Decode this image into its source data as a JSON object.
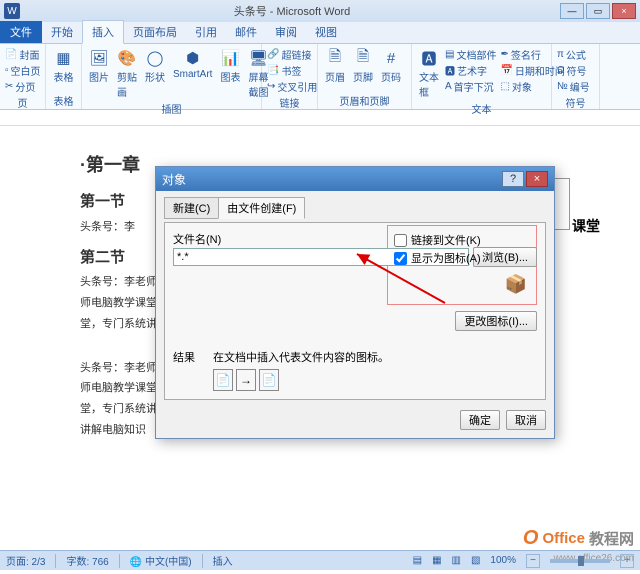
{
  "window": {
    "title": "头条号 - Microsoft Word",
    "min": "—",
    "max": "▭",
    "close": "×"
  },
  "ribbon": {
    "file": "文件",
    "tabs": [
      "开始",
      "插入",
      "页面布局",
      "引用",
      "邮件",
      "审阅",
      "视图"
    ],
    "active": 1,
    "groups": {
      "pages": {
        "label": "页",
        "items": [
          "封面",
          "空白页",
          "分页"
        ]
      },
      "table": {
        "label": "表格",
        "btn": "表格"
      },
      "illus": {
        "label": "插图",
        "items": [
          "图片",
          "剪贴画",
          "形状",
          "SmartArt",
          "图表",
          "屏幕截图"
        ]
      },
      "links": {
        "label": "链接",
        "items": [
          "超链接",
          "书签",
          "交叉引用"
        ]
      },
      "header": {
        "label": "页眉和页脚",
        "items": [
          "页眉",
          "页脚",
          "页码"
        ]
      },
      "text": {
        "label": "文本",
        "big": "文本框",
        "items": [
          "文档部件",
          "艺术字",
          "首字下沉",
          "签名行",
          "日期和时间",
          "对象"
        ]
      },
      "symbol": {
        "label": "符号",
        "items": [
          "公式",
          "符号",
          "编号"
        ]
      }
    }
  },
  "doc": {
    "h1": "·第一章",
    "h2a": "第一节",
    "h2b": "第二节",
    "p1": "头条号：李",
    "side": "课堂",
    "para1": "头条号：李老师电脑教学课堂，专门系统讲解电脑知识，软件使用技巧，欢迎关注。头条号：李老师电脑教学课堂，专门系统讲解电脑知识，软件使用技巧，欢迎关注。头条号：李老师电脑教学课堂，专门系统讲解电脑知识，软件使用技巧，欢迎关注。",
    "para2": "头条号：李老师电脑教学课堂，专门系统讲解电脑知识，软件使用技巧，欢迎关注。头条号：李老师电脑教学课堂，专门系统讲解电脑知识，软件使用技巧，欢迎关注。头条号：李老师电脑教学课堂，专门系统讲解电脑知识，软件使用技巧，欢迎关注。头条号：李老师电脑教学课堂，专门系统讲解电脑知识"
  },
  "dialog": {
    "title": "对象",
    "help": "?",
    "close": "×",
    "tab_new": "新建(C)",
    "tab_file": "由文件创建(F)",
    "filename_label": "文件名(N)",
    "filename_value": "*.*",
    "browse": "浏览(B)...",
    "chk_link": "链接到文件(K)",
    "chk_icon": "显示为图标(A)",
    "change_icon": "更改图标(I)...",
    "result_label": "结果",
    "result_desc": "在文档中插入代表文件内容的图标。",
    "ok": "确定",
    "cancel": "取消"
  },
  "status": {
    "page": "页面: 2/3",
    "words": "字数: 766",
    "lang": "中文(中国)",
    "mode": "插入",
    "zoom": "100%",
    "minus": "−",
    "plus": "+"
  },
  "watermark": {
    "brand1": "Office",
    "brand2": "教程网",
    "url": "www.office26.com"
  }
}
